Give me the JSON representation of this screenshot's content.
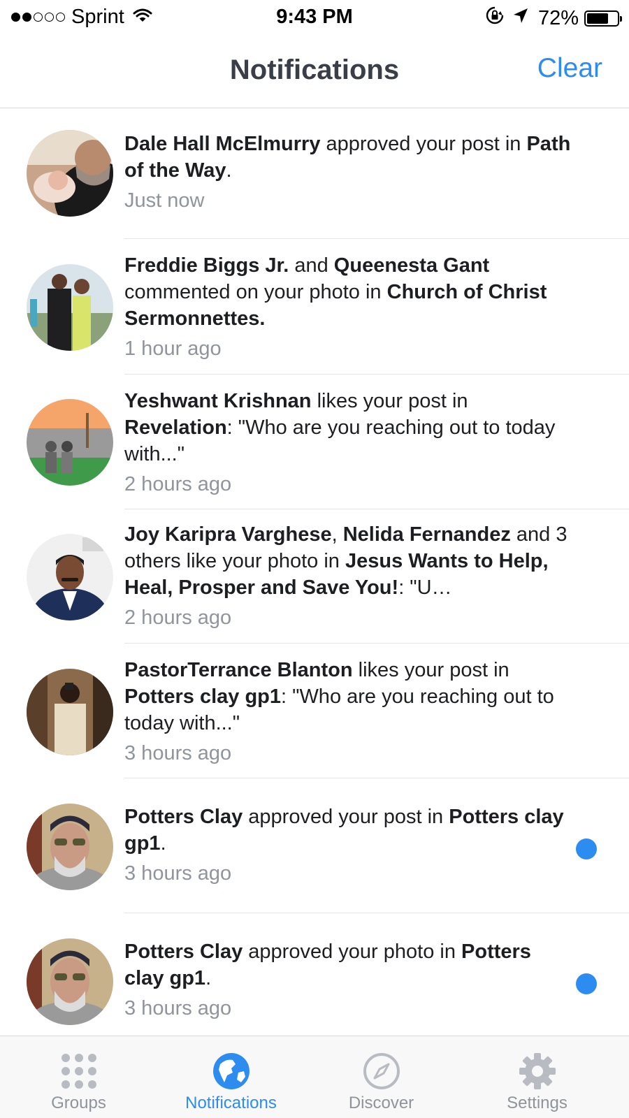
{
  "status_bar": {
    "carrier": "Sprint",
    "time": "9:43 PM",
    "battery": "72%",
    "battery_level": 0.72,
    "signal_dots": [
      true,
      true,
      false,
      false,
      false
    ]
  },
  "nav": {
    "title": "Notifications",
    "clear_label": "Clear"
  },
  "colors": {
    "accent": "#2d8cf0",
    "text": "#1c1e21",
    "muted": "#90949c"
  },
  "notifications": [
    {
      "segments": [
        {
          "text": "Dale Hall McElmurry",
          "bold": true
        },
        {
          "text": " approved your post in ",
          "bold": false
        },
        {
          "text": "Path of the Way",
          "bold": true
        },
        {
          "text": ".",
          "bold": false
        }
      ],
      "time": "Just now",
      "unread": false
    },
    {
      "segments": [
        {
          "text": "Freddie Biggs Jr.",
          "bold": true
        },
        {
          "text": " and ",
          "bold": false
        },
        {
          "text": "Queenesta Gant",
          "bold": true
        },
        {
          "text": " commented on your photo in ",
          "bold": false
        },
        {
          "text": "Church of Christ Sermonnettes.",
          "bold": true
        }
      ],
      "time": "1 hour ago",
      "unread": false
    },
    {
      "segments": [
        {
          "text": "Yeshwant Krishnan",
          "bold": true
        },
        {
          "text": " likes your post in ",
          "bold": false
        },
        {
          "text": "Revelation",
          "bold": true
        },
        {
          "text": ": \"Who are you reaching out to today with...\"",
          "bold": false
        }
      ],
      "time": "2 hours ago",
      "unread": false
    },
    {
      "segments": [
        {
          "text": "Joy Karipra Varghese",
          "bold": true
        },
        {
          "text": ", ",
          "bold": false
        },
        {
          "text": "Nelida Fernandez",
          "bold": true
        },
        {
          "text": " and 3 others like your photo in ",
          "bold": false
        },
        {
          "text": "Jesus Wants to Help, Heal, Prosper and Save You!",
          "bold": true
        },
        {
          "text": ": \"U…",
          "bold": false
        }
      ],
      "time": "2 hours ago",
      "unread": false
    },
    {
      "segments": [
        {
          "text": "PastorTerrance Blanton",
          "bold": true
        },
        {
          "text": " likes your post in ",
          "bold": false
        },
        {
          "text": "Potters clay gp1",
          "bold": true
        },
        {
          "text": ": \"Who are you reaching out to today with...\"",
          "bold": false
        }
      ],
      "time": "3 hours ago",
      "unread": false
    },
    {
      "segments": [
        {
          "text": "Potters Clay",
          "bold": true
        },
        {
          "text": " approved your post in ",
          "bold": false
        },
        {
          "text": "Potters clay gp1",
          "bold": true
        },
        {
          "text": ".",
          "bold": false
        }
      ],
      "time": "3 hours ago",
      "unread": true
    },
    {
      "segments": [
        {
          "text": "Potters Clay",
          "bold": true
        },
        {
          "text": " approved your photo in ",
          "bold": false
        },
        {
          "text": "Potters clay gp1",
          "bold": true
        },
        {
          "text": ".",
          "bold": false
        }
      ],
      "time": "3 hours ago",
      "unread": true
    }
  ],
  "tabs": [
    {
      "label": "Groups",
      "icon": "groups-grid-icon",
      "active": false
    },
    {
      "label": "Notifications",
      "icon": "globe-icon",
      "active": true
    },
    {
      "label": "Discover",
      "icon": "compass-icon",
      "active": false
    },
    {
      "label": "Settings",
      "icon": "gear-icon",
      "active": false
    }
  ]
}
